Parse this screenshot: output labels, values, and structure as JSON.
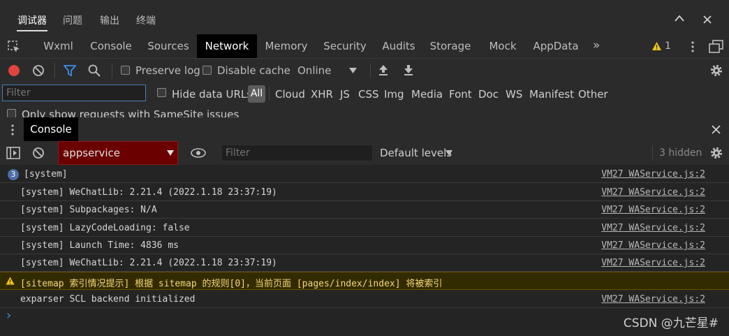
{
  "top_tabs": [
    {
      "label": "调试器",
      "active": true
    },
    {
      "label": "问题"
    },
    {
      "label": "输出"
    },
    {
      "label": "终端"
    }
  ],
  "dev_tabs": [
    "Wxml",
    "Console",
    "Sources",
    "Network",
    "Memory",
    "Security",
    "Audits",
    "Storage",
    "Mock",
    "AppData"
  ],
  "dev_active": "Network",
  "warning_count": "1",
  "network_toolbar": {
    "preserve_log": "Preserve log",
    "disable_cache": "Disable cache",
    "throttle": "Online"
  },
  "filter_row": {
    "placeholder": "Filter",
    "hide_data_urls": "Hide data URLs",
    "all": "All",
    "types": [
      "Cloud",
      "XHR",
      "JS",
      "CSS",
      "Img",
      "Media",
      "Font",
      "Doc",
      "WS",
      "Manifest",
      "Other"
    ]
  },
  "samesite_label": "Only show requests with SameSite issues",
  "drawer": {
    "tab": "Console"
  },
  "console_toolbar": {
    "context": "appservice",
    "filter_placeholder": "Filter",
    "levels": "Default levels",
    "hidden": "3 hidden"
  },
  "messages": [
    {
      "badge": "3",
      "text": "[system]",
      "source": "VM27 WAService.js:2"
    },
    {
      "text": "[system] WeChatLib: 2.21.4 (2022.1.18 23:37:19)",
      "source": "VM27 WAService.js:2"
    },
    {
      "text": "[system] Subpackages: N/A",
      "source": "VM27 WAService.js:2"
    },
    {
      "text": "[system] LazyCodeLoading: false",
      "source": "VM27 WAService.js:2"
    },
    {
      "text": "[system] Launch Time: 4836 ms",
      "source": "VM27 WAService.js:2"
    },
    {
      "text": "[system] WeChatLib: 2.21.4 (2022.1.18 23:37:19)",
      "source": "VM27 WAService.js:2"
    },
    {
      "text": "[sitemap 索引情况提示] 根据 sitemap 的规则[0]，当前页面 [pages/index/index] 将被索引",
      "warning": true
    },
    {
      "text": "exparser SCL backend initialized",
      "source": "VM27 WAService.js:2"
    }
  ],
  "prompt": "›",
  "watermark": "CSDN @九芒星#",
  "colors": {
    "record": "#e0443e",
    "filter_icon": "#3b8eea",
    "warning_icon": "#f5c518",
    "context_bg": "#6a0000"
  }
}
